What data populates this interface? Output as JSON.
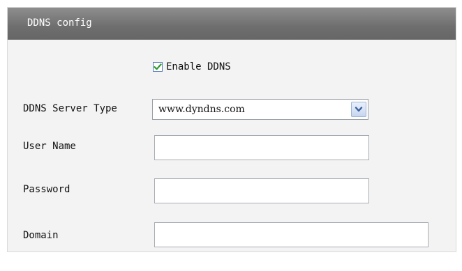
{
  "panel": {
    "title": "DDNS config"
  },
  "enable_ddns": {
    "label": "Enable DDNS",
    "checked": true
  },
  "fields": {
    "server_type_label": "DDNS Server Type",
    "server_type_value": "www.dyndns.com",
    "user_name_label": "User Name",
    "user_name_value": "",
    "password_label": "Password",
    "password_value": "",
    "domain_label": "Domain",
    "domain_value": ""
  },
  "colors": {
    "header_bg": "#7a7a7a",
    "panel_bg": "#f3f3f3",
    "check_mark": "#2e9a2e"
  }
}
